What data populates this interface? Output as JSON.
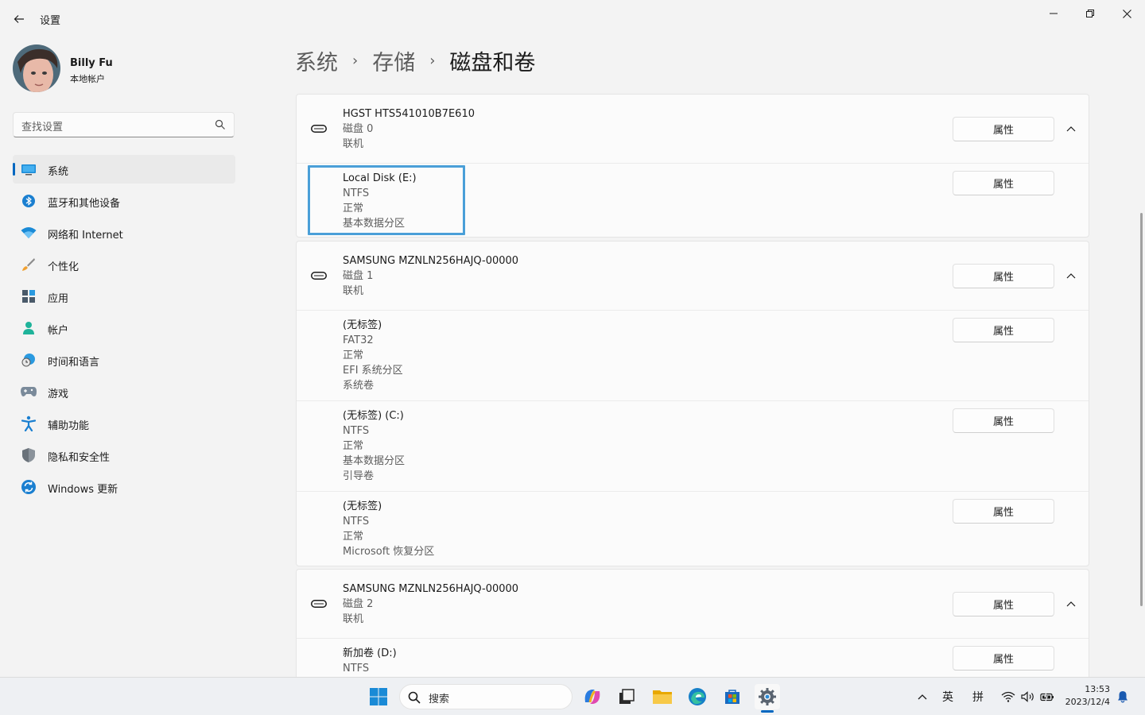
{
  "window": {
    "title": "设置"
  },
  "profile": {
    "name": "Billy Fu",
    "account_type": "本地帐户"
  },
  "search": {
    "placeholder": "查找设置"
  },
  "sidebar": {
    "items": [
      {
        "label": "系统",
        "icon": "monitor-icon",
        "active": true
      },
      {
        "label": "蓝牙和其他设备",
        "icon": "bluetooth-icon"
      },
      {
        "label": "网络和 Internet",
        "icon": "wifi-icon"
      },
      {
        "label": "个性化",
        "icon": "brush-icon"
      },
      {
        "label": "应用",
        "icon": "apps-icon"
      },
      {
        "label": "帐户",
        "icon": "person-icon"
      },
      {
        "label": "时间和语言",
        "icon": "globe-clock-icon"
      },
      {
        "label": "游戏",
        "icon": "gamepad-icon"
      },
      {
        "label": "辅助功能",
        "icon": "accessibility-icon"
      },
      {
        "label": "隐私和安全性",
        "icon": "shield-icon"
      },
      {
        "label": "Windows 更新",
        "icon": "update-icon"
      }
    ]
  },
  "breadcrumb": {
    "level1": "系统",
    "level2": "存储",
    "current": "磁盘和卷",
    "separator": "›"
  },
  "button_label": "属性",
  "disks": [
    {
      "name": "HGST HTS541010B7E610",
      "number": "磁盘 0",
      "status": "联机",
      "volumes": [
        {
          "lines": [
            "Local Disk (E:)",
            "NTFS",
            "正常",
            "基本数据分区"
          ]
        }
      ]
    },
    {
      "name": "SAMSUNG MZNLN256HAJQ-00000",
      "number": "磁盘 1",
      "status": "联机",
      "volumes": [
        {
          "lines": [
            "(无标签)",
            "FAT32",
            "正常",
            "EFI 系统分区",
            "系统卷"
          ]
        },
        {
          "lines": [
            "(无标签) (C:)",
            "NTFS",
            "正常",
            "基本数据分区",
            "引导卷"
          ]
        },
        {
          "lines": [
            "(无标签)",
            "NTFS",
            "正常",
            "Microsoft 恢复分区"
          ]
        }
      ]
    },
    {
      "name": "SAMSUNG MZNLN256HAJQ-00000",
      "number": "磁盘 2",
      "status": "联机",
      "volumes": [
        {
          "lines": [
            "新加卷 (D:)",
            "NTFS"
          ]
        }
      ]
    }
  ],
  "taskbar": {
    "search_label": "搜索",
    "ime_lang": "英",
    "ime_mode": "拼",
    "time": "13:53",
    "date": "2023/12/4"
  },
  "colors": {
    "accent": "#0067c0",
    "highlight": "#4a9fd8"
  }
}
